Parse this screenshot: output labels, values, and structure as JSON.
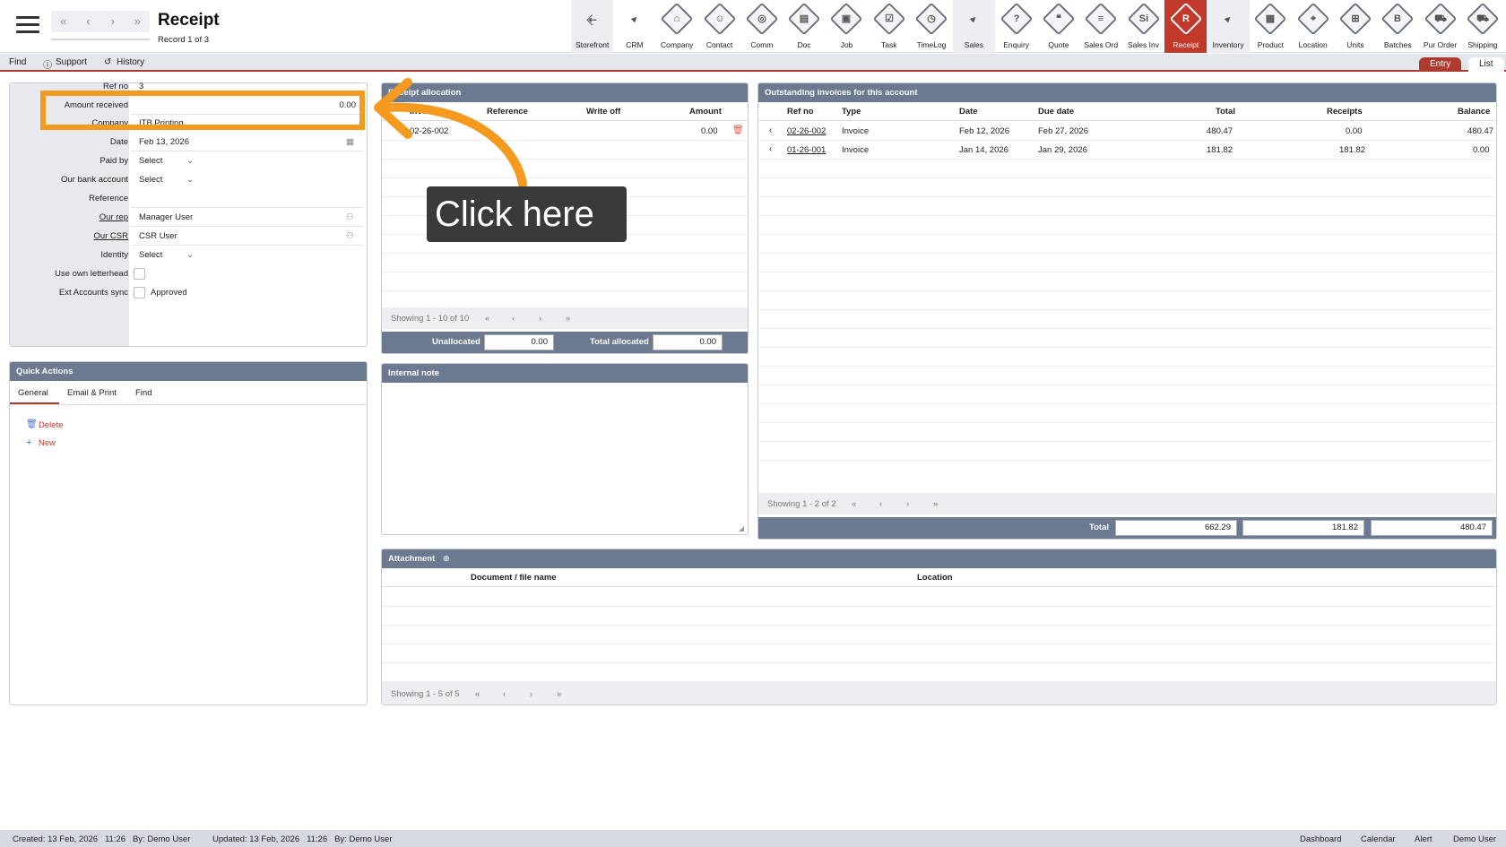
{
  "header": {
    "title": "Receipt",
    "record": "Record 1 of 3",
    "nav": [
      "«",
      "‹",
      "›",
      "»"
    ]
  },
  "modules": [
    {
      "label": "Storefront",
      "glyph": "⇱",
      "kind": "plain"
    },
    {
      "label": "CRM",
      "glyph": "▸",
      "kind": "arrow"
    },
    {
      "label": "Company",
      "glyph": "⌂",
      "kind": "icon"
    },
    {
      "label": "Contact",
      "glyph": "☺",
      "kind": "icon"
    },
    {
      "label": "Comm",
      "glyph": "◎",
      "kind": "icon"
    },
    {
      "label": "Doc",
      "glyph": "▤",
      "kind": "icon"
    },
    {
      "label": "Job",
      "glyph": "▣",
      "kind": "icon"
    },
    {
      "label": "Task",
      "glyph": "☑",
      "kind": "icon"
    },
    {
      "label": "TimeLog",
      "glyph": "◷",
      "kind": "icon"
    },
    {
      "label": "Sales",
      "glyph": "▸",
      "kind": "arrow"
    },
    {
      "label": "Enquiry",
      "glyph": "?",
      "kind": "icon"
    },
    {
      "label": "Quote",
      "glyph": "❝",
      "kind": "icon"
    },
    {
      "label": "Sales Ord",
      "glyph": "≡",
      "kind": "icon"
    },
    {
      "label": "Sales Inv",
      "glyph": "Si",
      "kind": "icon"
    },
    {
      "label": "Receipt",
      "glyph": "R",
      "kind": "active"
    },
    {
      "label": "Inventory",
      "glyph": "▸",
      "kind": "arrow"
    },
    {
      "label": "Product",
      "glyph": "▦",
      "kind": "icon"
    },
    {
      "label": "Location",
      "glyph": "⌖",
      "kind": "icon"
    },
    {
      "label": "Units",
      "glyph": "⊞",
      "kind": "icon"
    },
    {
      "label": "Batches",
      "glyph": "B",
      "kind": "icon"
    },
    {
      "label": "Pur Order",
      "glyph": "⛟",
      "kind": "icon"
    },
    {
      "label": "Shipping",
      "glyph": "⛟",
      "kind": "icon"
    }
  ],
  "subbar": {
    "find": "Find",
    "support": "Support",
    "history": "History",
    "entry": "Entry",
    "list": "List"
  },
  "form": {
    "ref_no_label": "Ref no",
    "ref_no_value": "3",
    "amount_label": "Amount received",
    "amount_value": "0.00",
    "company_label": "Company",
    "company_value": "ITB Printing",
    "date_label": "Date",
    "date_value": "Feb 13, 2026",
    "paid_by_label": "Paid by",
    "paid_by_value": "Select",
    "bank_label": "Our bank account",
    "bank_value": "Select",
    "reference_label": "Reference",
    "reference_value": "",
    "rep_label": "Our rep",
    "rep_value": "Manager User",
    "csr_label": "Our CSR",
    "csr_value": "CSR User",
    "identity_label": "Identity",
    "identity_value": "Select",
    "letterhead_label": "Use own letterhead",
    "sync_label": "Ext Accounts sync",
    "sync_value": "Approved"
  },
  "quick_actions": {
    "title": "Quick Actions",
    "tabs": [
      "General",
      "Email & Print",
      "Find"
    ],
    "delete": "Delete",
    "new": "New"
  },
  "allocation": {
    "title": "Receipt allocation",
    "columns": [
      "Invoice",
      "Reference",
      "Write off",
      "Amount"
    ],
    "rows": [
      {
        "invoice": "02-26-002",
        "reference": "",
        "write_off": "",
        "amount": "0.00"
      }
    ],
    "pager": "Showing 1 - 10 of 10",
    "unallocated_label": "Unallocated",
    "unallocated_value": "0.00",
    "total_allocated_label": "Total allocated",
    "total_allocated_value": "0.00"
  },
  "internal_note": {
    "title": "Internal note"
  },
  "outstanding": {
    "title": "Outstanding invoices for this account",
    "columns": [
      "Ref no",
      "Type",
      "Date",
      "Due date",
      "Total",
      "Receipts",
      "Balance"
    ],
    "rows": [
      {
        "ref": "02-26-002",
        "type": "Invoice",
        "date": "Feb 12, 2026",
        "due": "Feb 27, 2026",
        "total": "480.47",
        "receipts": "0.00",
        "balance": "480.47"
      },
      {
        "ref": "01-26-001",
        "type": "Invoice",
        "date": "Jan 14, 2026",
        "due": "Jan 29, 2026",
        "total": "181.82",
        "receipts": "181.82",
        "balance": "0.00"
      }
    ],
    "pager": "Showing 1 - 2 of 2",
    "total_label": "Total",
    "total_total": "662.29",
    "total_receipts": "181.82",
    "total_balance": "480.47"
  },
  "attachment": {
    "title": "Attachment",
    "columns": [
      "Document / file name",
      "Location"
    ],
    "pager": "Showing 1 - 5 of 5"
  },
  "footer": {
    "created": "Created: 13 Feb, 2026   11:26   By: Demo User",
    "updated": "Updated: 13 Feb, 2026   11:26   By: Demo User",
    "links": [
      "Dashboard",
      "Calendar",
      "Alert",
      "Demo User"
    ]
  },
  "callout": {
    "text": "Click here"
  },
  "colors": {
    "accent": "#c0392b",
    "panel_header": "#6c7a91",
    "highlight": "#f39a1f",
    "callout_bg": "#3a3a3a"
  }
}
